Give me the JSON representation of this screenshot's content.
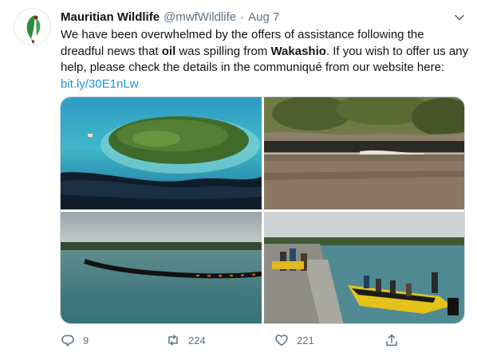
{
  "tweet": {
    "author_name": "Mauritian Wildlife",
    "author_handle": "@mwfWildlife",
    "separator": "·",
    "date": "Aug 7",
    "text_1": "We have been overwhelmed by the offers of assistance following the dreadful news that ",
    "bold_1": "oil",
    "text_2": " was spilling from ",
    "bold_2": "Wakashio",
    "text_3": ". If you wish to offer us any help, please check the details in the communiqué from our website here: ",
    "link": "bit.ly/30E1nLw"
  },
  "media": {
    "images": [
      {
        "icon": "aerial-island-oil-slick-photo"
      },
      {
        "icon": "oily-shoreline-rocks-photo"
      },
      {
        "icon": "oil-boom-in-lagoon-photo"
      },
      {
        "icon": "volunteers-boat-at-jetty-photo"
      }
    ]
  },
  "actions": {
    "replies": "9",
    "retweets": "224",
    "likes": "221"
  },
  "icons": {
    "reply": "reply-icon",
    "retweet": "retweet-icon",
    "like": "heart-icon",
    "share": "share-icon",
    "more": "chevron-down-icon"
  },
  "colors": {
    "link": "#1b95e0",
    "secondary_text": "#5b7083",
    "primary_text": "#0f1419",
    "logo_green": "#2e8b3a",
    "logo_brown": "#6b3b1f"
  }
}
